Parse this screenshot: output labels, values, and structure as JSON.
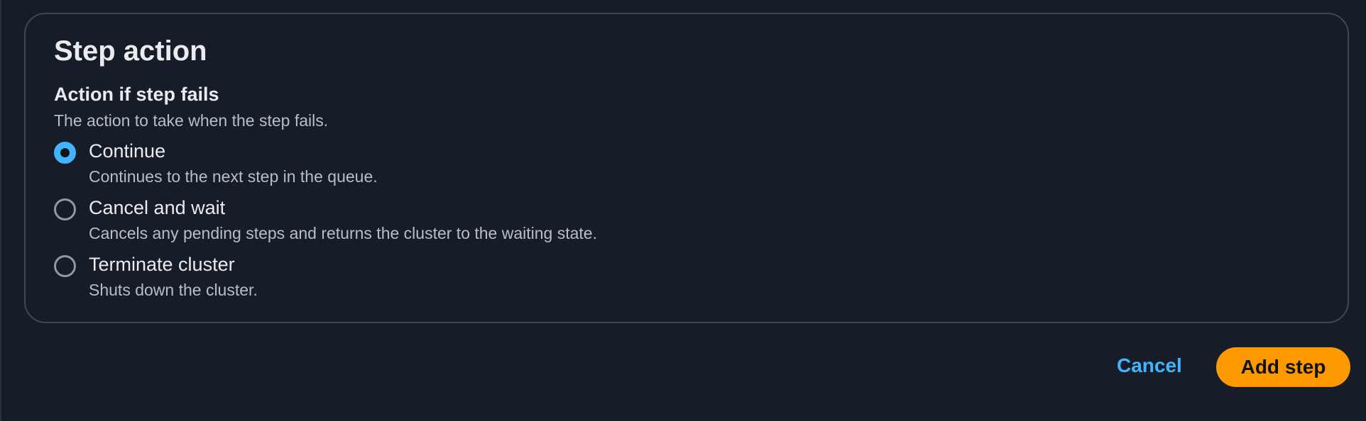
{
  "panel": {
    "title": "Step action",
    "field": {
      "label": "Action if step fails",
      "description": "The action to take when the step fails."
    },
    "options": [
      {
        "label": "Continue",
        "description": "Continues to the next step in the queue.",
        "selected": true
      },
      {
        "label": "Cancel and wait",
        "description": "Cancels any pending steps and returns the cluster to the waiting state.",
        "selected": false
      },
      {
        "label": "Terminate cluster",
        "description": "Shuts down the cluster.",
        "selected": false
      }
    ]
  },
  "footer": {
    "cancel_label": "Cancel",
    "submit_label": "Add step"
  },
  "colors": {
    "background": "#161d29",
    "accent_blue": "#42b4ff",
    "primary_orange": "#ff9900",
    "panel_border": "#414750"
  }
}
